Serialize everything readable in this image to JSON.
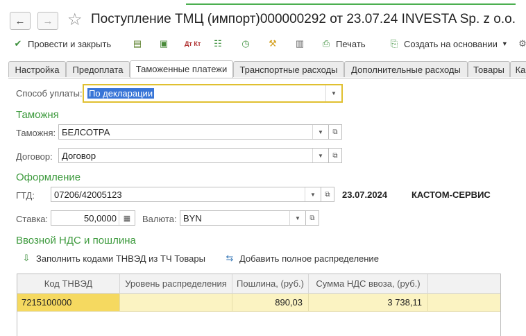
{
  "header": {
    "title": "Поступление ТМЦ (импорт)000000292 от 23.07.24 INVESTA Sp. z o.o.",
    "back_icon": "arrow-left-icon",
    "forward_icon": "arrow-right-icon",
    "favorite_icon": "star-icon"
  },
  "toolbar": {
    "post_close_label": "Провести и закрыть",
    "print_label": "Печать",
    "create_based_label": "Создать на основании",
    "dtkt_label": "Дт Кт"
  },
  "tabs": [
    {
      "label": "Настройка"
    },
    {
      "label": "Предоплата"
    },
    {
      "label": "Таможенные платежи",
      "active": true
    },
    {
      "label": "Транспортные расходы"
    },
    {
      "label": "Дополнительные расходы"
    },
    {
      "label": "Товары"
    },
    {
      "label": "Ка"
    }
  ],
  "form": {
    "payment_method_label": "Способ уплаты:",
    "payment_method_value": "По декларации",
    "customs_section": "Таможня",
    "customs_label": "Таможня:",
    "customs_value": "БЕЛСОТРА",
    "contract_label": "Договор:",
    "contract_value": "Договор",
    "registration_section": "Оформление",
    "gtd_label": "ГТД:",
    "gtd_value": "07206/42005123",
    "gtd_date": "23.07.2024",
    "broker": "КАСТОМ-СЕРВИС",
    "rate_label": "Ставка:",
    "rate_value": "50,0000",
    "currency_label": "Валюта:",
    "currency_value": "BYN",
    "vat_section": "Ввозной НДС и пошлина",
    "fill_codes_label": "Заполнить кодами ТНВЭД из ТЧ Товары",
    "add_distribution_label": "Добавить полное распределение"
  },
  "table": {
    "columns": [
      "Код ТНВЭД",
      "Уровень распределения",
      "Пошлина, (руб.)",
      "Сумма НДС ввоза, (руб.)"
    ],
    "rows": [
      {
        "code": "7215100000",
        "level": "",
        "duty": "890,03",
        "vat": "3 738,11"
      }
    ]
  },
  "colors": {
    "section_green": "#3d9a3d",
    "selected_row": "#fbf3c2",
    "focus_border": "#e0c030",
    "selection_blue": "#3875d7"
  }
}
